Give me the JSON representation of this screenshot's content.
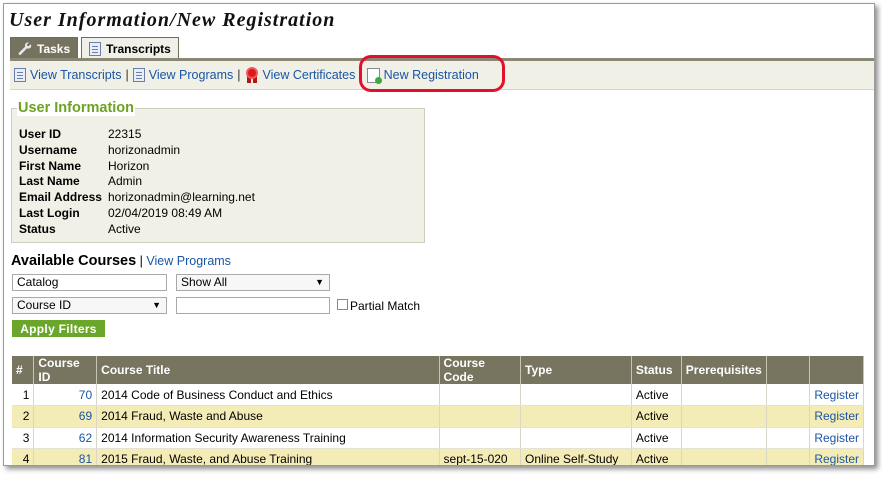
{
  "page": {
    "title": "User Information/New Registration"
  },
  "tabs": [
    {
      "label": "Tasks",
      "icon": "wrench-icon",
      "active": false
    },
    {
      "label": "Transcripts",
      "icon": "document-icon",
      "active": true
    }
  ],
  "actions": {
    "view_transcripts": "View Transcripts",
    "view_programs": "View Programs",
    "view_certificates": "View Certificates",
    "new_registration": "New Registration",
    "separator": "|"
  },
  "user_info": {
    "legend": "User Information",
    "rows": [
      {
        "label": "User ID",
        "value": "22315"
      },
      {
        "label": "Username",
        "value": "horizonadmin"
      },
      {
        "label": "First Name",
        "value": "Horizon"
      },
      {
        "label": "Last Name",
        "value": "Admin"
      },
      {
        "label": "Email Address",
        "value": "horizonadmin@learning.net"
      },
      {
        "label": "Last Login",
        "value": "02/04/2019 08:49 AM"
      },
      {
        "label": "Status",
        "value": "Active"
      }
    ]
  },
  "available": {
    "heading": "Available Courses",
    "separator": "|",
    "view_programs": "View Programs"
  },
  "filters": {
    "catalog_value": "Catalog",
    "show_select": "Show All",
    "field_select": "Course ID",
    "search_value": "",
    "partial_match_label": "Partial Match",
    "apply_label": "Apply Filters"
  },
  "table": {
    "columns": [
      "#",
      "Course ID",
      "Course Title",
      "Course Code",
      "Type",
      "Status",
      "Prerequisites",
      "",
      ""
    ],
    "rows": [
      {
        "n": "1",
        "id": "70",
        "title": "2014 Code of Business Conduct and Ethics",
        "code": "",
        "type": "",
        "status": "Active",
        "prereq": "",
        "extra": "",
        "action": "Register"
      },
      {
        "n": "2",
        "id": "69",
        "title": "2014 Fraud, Waste and Abuse",
        "code": "",
        "type": "",
        "status": "Active",
        "prereq": "",
        "extra": "",
        "action": "Register"
      },
      {
        "n": "3",
        "id": "62",
        "title": "2014 Information Security Awareness Training",
        "code": "",
        "type": "",
        "status": "Active",
        "prereq": "",
        "extra": "",
        "action": "Register"
      },
      {
        "n": "4",
        "id": "81",
        "title": "2015 Fraud, Waste, and Abuse Training",
        "code": "sept-15-020",
        "type": "Online Self-Study",
        "status": "Active",
        "prereq": "",
        "extra": "",
        "action": "Register"
      }
    ]
  },
  "colors": {
    "tab_dark": "#75735f",
    "accent_green": "#6ca322",
    "link_blue": "#1a55a5",
    "highlight_red": "#e3102b",
    "row_alt": "#f4ecb7"
  }
}
